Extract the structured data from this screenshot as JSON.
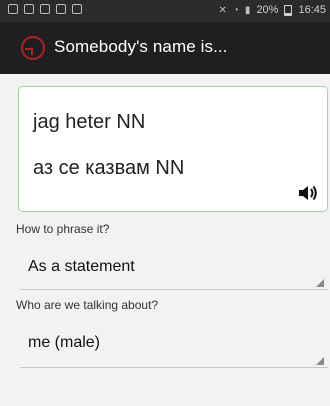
{
  "status_bar": {
    "time": "16:45",
    "battery_percent": "20%",
    "left_icons": [
      "rss-icon",
      "image-icon",
      "chat-icon",
      "app-icon",
      "save-icon"
    ],
    "right_icons": [
      "mute-icon",
      "wifi-icon",
      "signal-icon",
      "battery-icon"
    ]
  },
  "app_bar": {
    "title": "Somebody's name is...",
    "logo_icon": "app-logo-icon"
  },
  "translation_card": {
    "line1": "jag heter NN",
    "line2": "аз се казвам NN",
    "border_color": "#9fd6a0",
    "speaker_icon": "speaker-icon"
  },
  "phrase_field": {
    "label": "How to phrase it?",
    "selected": "As a statement"
  },
  "subject_field": {
    "label": "Who are we talking about?",
    "selected": "me (male)"
  }
}
